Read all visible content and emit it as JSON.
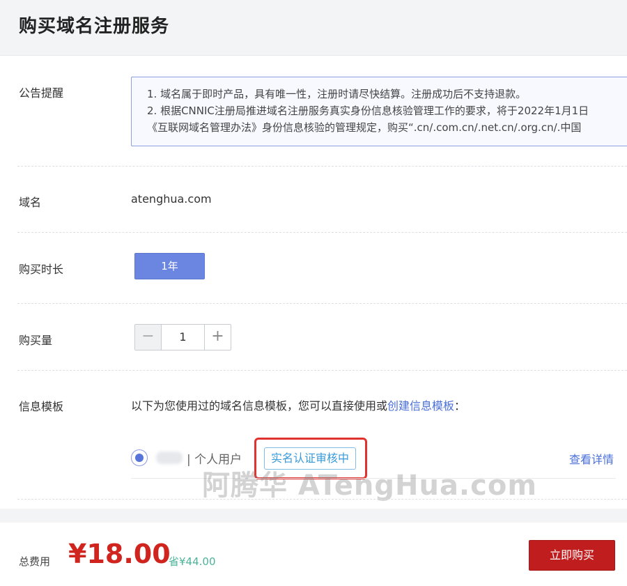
{
  "page_title": "购买域名注册服务",
  "notice": {
    "label": "公告提醒",
    "lines": [
      "1. 域名属于即时产品，具有唯一性，注册时请尽快结算。注册成功后不支持退款。",
      "2. 根据CNNIC注册局推进域名注册服务真实身份信息核验管理工作的要求，将于2022年1月1日",
      "《互联网域名管理办法》身份信息核验的管理规定，购买“.cn/.com.cn/.net.cn/.org.cn/.中国"
    ]
  },
  "domain": {
    "label": "域名",
    "value": "atenghua.com"
  },
  "duration": {
    "label": "购买时长",
    "selected": "1年"
  },
  "quantity": {
    "label": "购买量",
    "value": "1",
    "minus": "−",
    "plus": "+"
  },
  "template": {
    "label": "信息模板",
    "description": "以下为您使用过的域名信息模板，您可以直接使用或",
    "create_link": "创建信息模板",
    "suffix": "：",
    "entry": {
      "user_type": "| 个人用户",
      "status": "实名认证审核中",
      "details_link": "查看详情"
    }
  },
  "watermark": "阿腾华 ATengHua.com",
  "footer": {
    "total_label": "总费用",
    "price": "¥18.00",
    "saving": "省¥44.00",
    "buy_button": "立即购买"
  },
  "colors": {
    "accent": "#6b86e0",
    "price": "#d0251f",
    "buy_button": "#c01e1e",
    "status": "#3a9ad9",
    "highlight": "#e0332f"
  }
}
